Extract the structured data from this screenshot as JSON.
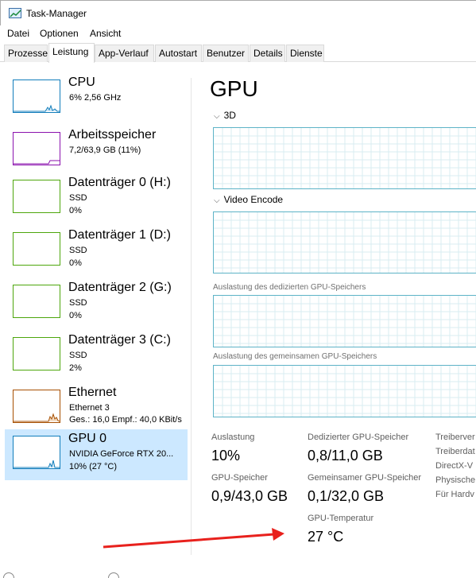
{
  "window": {
    "title": "Task-Manager"
  },
  "menu": [
    "Datei",
    "Optionen",
    "Ansicht"
  ],
  "tabs": [
    "Prozesse",
    "Leistung",
    "App-Verlauf",
    "Autostart",
    "Benutzer",
    "Details",
    "Dienste"
  ],
  "active_tab": "Leistung",
  "sidebar": {
    "items": [
      {
        "name": "CPU",
        "sub1": "6%  2,56 GHz",
        "sub2": "",
        "color": "#117dbb"
      },
      {
        "name": "Arbeitsspeicher",
        "sub1": "7,2/63,9 GB (11%)",
        "sub2": "",
        "color": "#8b12ae"
      },
      {
        "name": "Datenträger 0 (H:)",
        "sub1": "SSD",
        "sub2": "0%",
        "color": "#4da60c"
      },
      {
        "name": "Datenträger 1 (D:)",
        "sub1": "SSD",
        "sub2": "0%",
        "color": "#4da60c"
      },
      {
        "name": "Datenträger 2 (G:)",
        "sub1": "SSD",
        "sub2": "0%",
        "color": "#4da60c"
      },
      {
        "name": "Datenträger 3 (C:)",
        "sub1": "SSD",
        "sub2": "2%",
        "color": "#4da60c"
      },
      {
        "name": "Ethernet",
        "sub1": "Ethernet 3",
        "sub2": "Ges.: 16,0  Empf.: 40,0 KBit/s",
        "color": "#a74f01"
      },
      {
        "name": "GPU 0",
        "sub1": "NVIDIA GeForce RTX 20...",
        "sub2": "10% (27 °C)",
        "color": "#117dbb"
      }
    ]
  },
  "main": {
    "title": "GPU",
    "sections": {
      "s3d": "3D",
      "video_encode": "Video Encode",
      "dedicated_usage": "Auslastung des dedizierten GPU-Speichers",
      "shared_usage": "Auslastung des gemeinsamen GPU-Speichers"
    },
    "stats": {
      "auslastung_label": "Auslastung",
      "auslastung_value": "10%",
      "dedicated_label": "Dedizierter GPU-Speicher",
      "dedicated_value": "0,8/11,0 GB",
      "gpu_mem_label": "GPU-Speicher",
      "gpu_mem_value": "0,9/43,0 GB",
      "shared_label": "Gemeinsamer GPU-Speicher",
      "shared_value": "0,1/32,0 GB",
      "temp_label": "GPU-Temperatur",
      "temp_value": "27 °C"
    },
    "side_props": [
      "Treiberver",
      "Treiberdat",
      "DirectX-V",
      "Physische",
      "Für Hardv"
    ]
  },
  "colors": {
    "graph_border": "#5db3c7",
    "grid": "#d9ecf2",
    "selected_bg": "#cce8ff",
    "arrow": "#e8211d"
  }
}
